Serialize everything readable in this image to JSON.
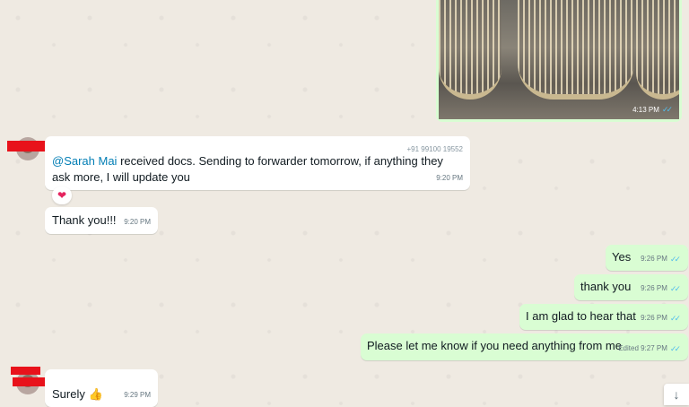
{
  "image_message": {
    "time": "4:13 PM",
    "ticks": "✓✓"
  },
  "incoming_1": {
    "sender_phone": "+91 99100 19552",
    "mention": "@Sarah Mai",
    "text": " received docs. Sending to forwarder tomorrow, if anything they ask more, I will update you",
    "time": "9:20 PM",
    "reaction": "❤"
  },
  "incoming_2": {
    "text": "Thank you!!!",
    "time": "9:20 PM"
  },
  "outgoing": [
    {
      "text": "Yes",
      "time": "9:26 PM",
      "ticks": "✓✓"
    },
    {
      "text": "thank you",
      "time": "9:26 PM",
      "ticks": "✓✓"
    },
    {
      "text": "I am glad to hear that",
      "time": "9:26 PM",
      "ticks": "✓✓"
    },
    {
      "text": "Please let me know if you need anything from me",
      "time": "Edited 9:27 PM",
      "ticks": "✓✓"
    }
  ],
  "incoming_3": {
    "text": "Surely 👍",
    "time": "9:29 PM"
  },
  "scroll_down_icon": "↓",
  "colors": {
    "outgoing_bubble": "#d9fdd3",
    "incoming_bubble": "#ffffff",
    "read_ticks": "#53bdeb",
    "redaction": "#e8121b",
    "chat_bg": "#efeae2"
  }
}
